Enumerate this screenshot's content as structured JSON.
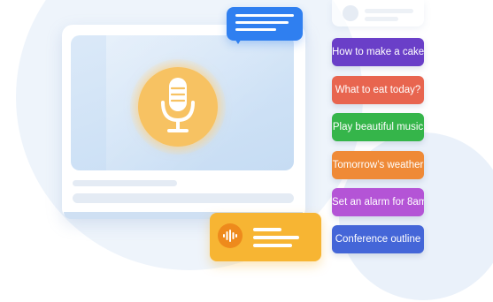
{
  "commands": [
    {
      "label": "How to make a cake",
      "color": "#6a3fc8"
    },
    {
      "label": "What to eat today?",
      "color": "#e8654f"
    },
    {
      "label": "Play beautiful music",
      "color": "#35b54a"
    },
    {
      "label": "Tomorrow’s weather",
      "color": "#ef8a37"
    },
    {
      "label": "Set an alarm for 8am",
      "color": "#b454d6"
    },
    {
      "label": "Conference outline",
      "color": "#4466d8"
    }
  ],
  "icons": {
    "microphone": "microphone-icon",
    "chat": "chat-bubble-icon",
    "voice": "sound-wave-icon"
  },
  "colors": {
    "mic_accent": "#f7c262",
    "chat_accent": "#2f7ff0",
    "voice_accent": "#f7b533"
  }
}
